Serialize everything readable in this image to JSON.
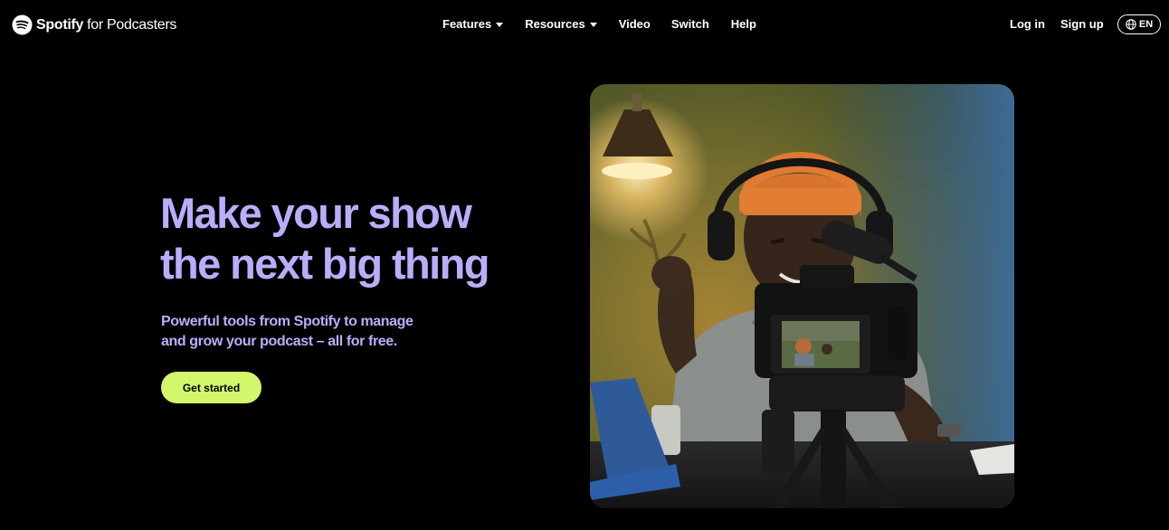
{
  "brand": {
    "name": "Spotify",
    "suffix": "for Podcasters",
    "logo_icon": "spotify-logo-icon",
    "color": "#ffffff"
  },
  "nav": {
    "items": [
      {
        "label": "Features",
        "has_dropdown": true
      },
      {
        "label": "Resources",
        "has_dropdown": true
      },
      {
        "label": "Video",
        "has_dropdown": false
      },
      {
        "label": "Switch",
        "has_dropdown": false
      },
      {
        "label": "Help",
        "has_dropdown": false
      }
    ]
  },
  "auth": {
    "login_label": "Log in",
    "signup_label": "Sign up"
  },
  "language": {
    "label": "EN",
    "icon": "globe-icon"
  },
  "hero": {
    "headline_line1": "Make your show",
    "headline_line2": "the next big thing",
    "subhead_line1": "Powerful tools from Spotify to manage",
    "subhead_line2": "and grow your podcast – all for free.",
    "cta_label": "Get started",
    "headline_color": "#b9aefb",
    "cta_color": "#d2f66c"
  },
  "media": {
    "type": "video",
    "description_icon": "podcaster-video"
  },
  "colors": {
    "background": "#000000",
    "text": "#ffffff",
    "accent_purple": "#b9aefb",
    "accent_green": "#d2f66c"
  }
}
